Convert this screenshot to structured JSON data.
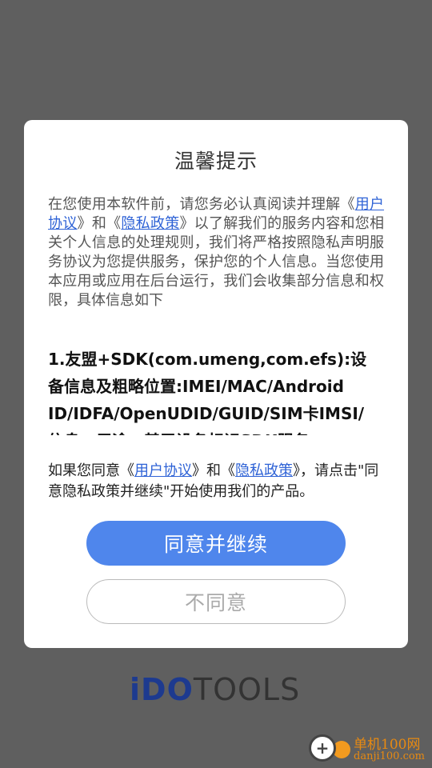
{
  "dialog": {
    "title": "温馨提示",
    "intro": {
      "part1": "在您使用本软件前，请您务必认真阅读并理解《",
      "link1": "用户协议",
      "part2": "》和《",
      "link2": "隐私政策",
      "part3": "》以了解我们的服务内容和您相关个人信息的处理规则，我们将严格按照隐私声明服务协议为您提供服务，保护您的个人信息。当您使用本应用或应用在后台运行，我们会收集部分信息和权限，具体信息如下"
    },
    "sdk_lines": [
      "1.友盟+SDK(com.umeng,com.efs):设",
      "备信息及粗略位置:IMEI/MAC/Android",
      "ID/IDFA/OpenUDID/GUID/SIM卡IMSI/",
      "信息，用途：基于设备标识SDK服务"
    ],
    "consent": {
      "part1": "如果您同意《",
      "link1": "用户协议",
      "part2": "》和《",
      "link2": "隐私政策",
      "part3": "》，请点击\"同意隐私政策并继续\"开始使用我们的产品。"
    },
    "agree_label": "同意并继续",
    "decline_label": "不同意"
  },
  "logo": {
    "part1": "iDO",
    "part2": "TOOLS"
  },
  "watermark": {
    "line1": "单机100网",
    "line2": "danji100.com",
    "icon": "plus-circle-icon"
  },
  "colors": {
    "accent": "#4f86ec",
    "link": "#2f63d6",
    "overlay": "#5f5f5f"
  }
}
